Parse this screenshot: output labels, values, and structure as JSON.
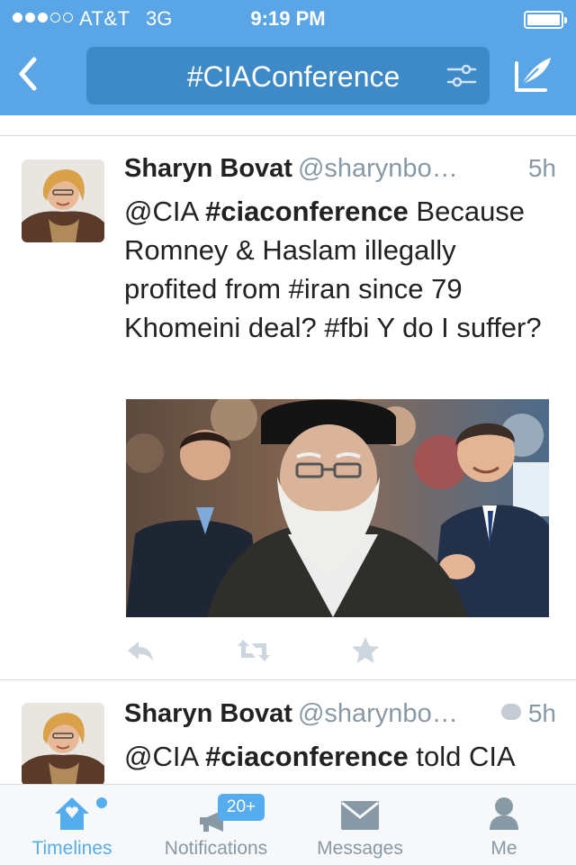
{
  "status_bar": {
    "carrier": "AT&T",
    "network": "3G",
    "time": "9:19 PM"
  },
  "nav": {
    "title": "#CIAConference",
    "icons": {
      "back": "chevron-left-icon",
      "filter": "sliders-icon",
      "compose": "compose-feather-icon"
    }
  },
  "tweets": [
    {
      "name": "Sharyn Bovat",
      "handle": "@sharynbo…",
      "time": "5h",
      "text_parts": {
        "a": "@CIA ",
        "b": "#ciaconference",
        "c": " Because Romney & Haslam illegally profited from #iran since 79 Khomeini deal? #fbi Y do I suffer?"
      },
      "actions": [
        "reply-icon",
        "retweet-icon",
        "favorite-star-icon"
      ]
    },
    {
      "name": "Sharyn Bovat",
      "handle": "@sharynbo…",
      "time": "5h",
      "has_reply_indicator": true,
      "text_parts": {
        "a": "@CIA ",
        "b": "#ciaconference",
        "c": " told CIA"
      }
    }
  ],
  "tabs": [
    {
      "label": "Timelines",
      "icon": "home-icon",
      "active": true,
      "dot": true
    },
    {
      "label": "Notifications",
      "icon": "megaphone-icon",
      "badge": "20+"
    },
    {
      "label": "Messages",
      "icon": "envelope-icon"
    },
    {
      "label": "Me",
      "icon": "person-icon"
    }
  ],
  "colors": {
    "header": "#5aa5e6",
    "accent": "#55acee",
    "muted": "#8899a6"
  }
}
